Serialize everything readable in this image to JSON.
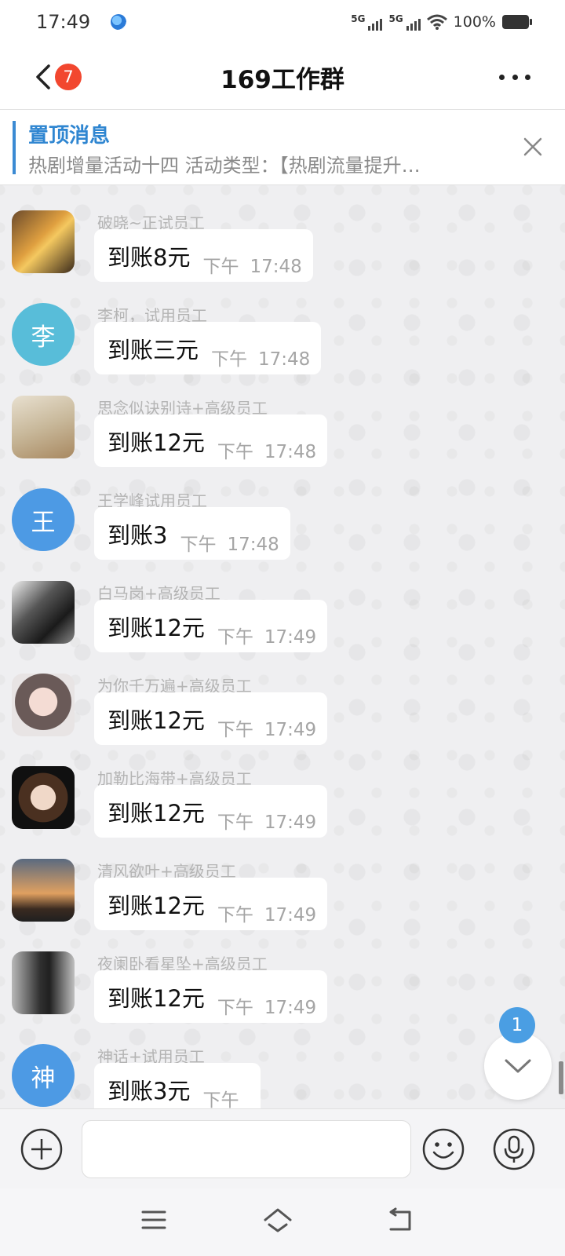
{
  "status_bar": {
    "time": "17:49",
    "network_1": "5G",
    "network_2": "5G",
    "battery_level": "100%",
    "icons": [
      "app-notification-icon",
      "signal-5g-icon",
      "signal-5g-icon",
      "wifi-icon",
      "battery-icon"
    ]
  },
  "header": {
    "title": "169工作群",
    "unread_count": "7",
    "icons": [
      "back-icon",
      "more-icon"
    ]
  },
  "pinned": {
    "title": "置顶消息",
    "text": "热剧增量活动十四 活动类型：【热剧流量提升…"
  },
  "messages": [
    {
      "sender": "破晓~正试员工",
      "text": "到账8元",
      "ampm": "下午",
      "time": "17:48",
      "avatar_letter": "",
      "avatar_color": "#c9a14a"
    },
    {
      "sender": "李柯，试用员工",
      "text": "到账三元",
      "ampm": "下午",
      "time": "17:48",
      "avatar_letter": "李",
      "avatar_color": "#58bdd9"
    },
    {
      "sender": "思念似诀别诗+高级员工",
      "text": "到账12元",
      "ampm": "下午",
      "time": "17:48",
      "avatar_letter": "",
      "avatar_color": "#c8b89a"
    },
    {
      "sender": "王学峰试用员工",
      "text": "到账3",
      "ampm": "下午",
      "time": "17:48",
      "avatar_letter": "王",
      "avatar_color": "#4d9ae4"
    },
    {
      "sender": "白马岗+高级员工",
      "text": "到账12元",
      "ampm": "下午",
      "time": "17:49",
      "avatar_letter": "",
      "avatar_color": "#3a3a3a"
    },
    {
      "sender": "为你千万遍+高级员工",
      "text": "到账12元",
      "ampm": "下午",
      "time": "17:49",
      "avatar_letter": "",
      "avatar_color": "#d8b8b0"
    },
    {
      "sender": "加勒比海带+高级员工",
      "text": "到账12元",
      "ampm": "下午",
      "time": "17:49",
      "avatar_letter": "",
      "avatar_color": "#5a4a40"
    },
    {
      "sender": "清风欲叶+高级员工",
      "text": "到账12元",
      "ampm": "下午",
      "time": "17:49",
      "avatar_letter": "",
      "avatar_color": "#d08a4a"
    },
    {
      "sender": "夜阑卧看星坠+高级员工",
      "text": "到账12元",
      "ampm": "下午",
      "time": "17:49",
      "avatar_letter": "",
      "avatar_color": "#7a7a7a"
    },
    {
      "sender": "神话+试用员工",
      "text": "到账3元",
      "ampm": "下午",
      "time": "",
      "avatar_letter": "神",
      "avatar_color": "#4d9ae4"
    }
  ],
  "scroll_down": {
    "unread_badge": "1"
  },
  "input_bar": {
    "message_value": "",
    "icons": [
      "add-icon",
      "emoji-icon",
      "microphone-icon"
    ]
  },
  "nav_bar": {
    "icons": [
      "menu-icon",
      "home-icon",
      "back-nav-icon"
    ]
  }
}
